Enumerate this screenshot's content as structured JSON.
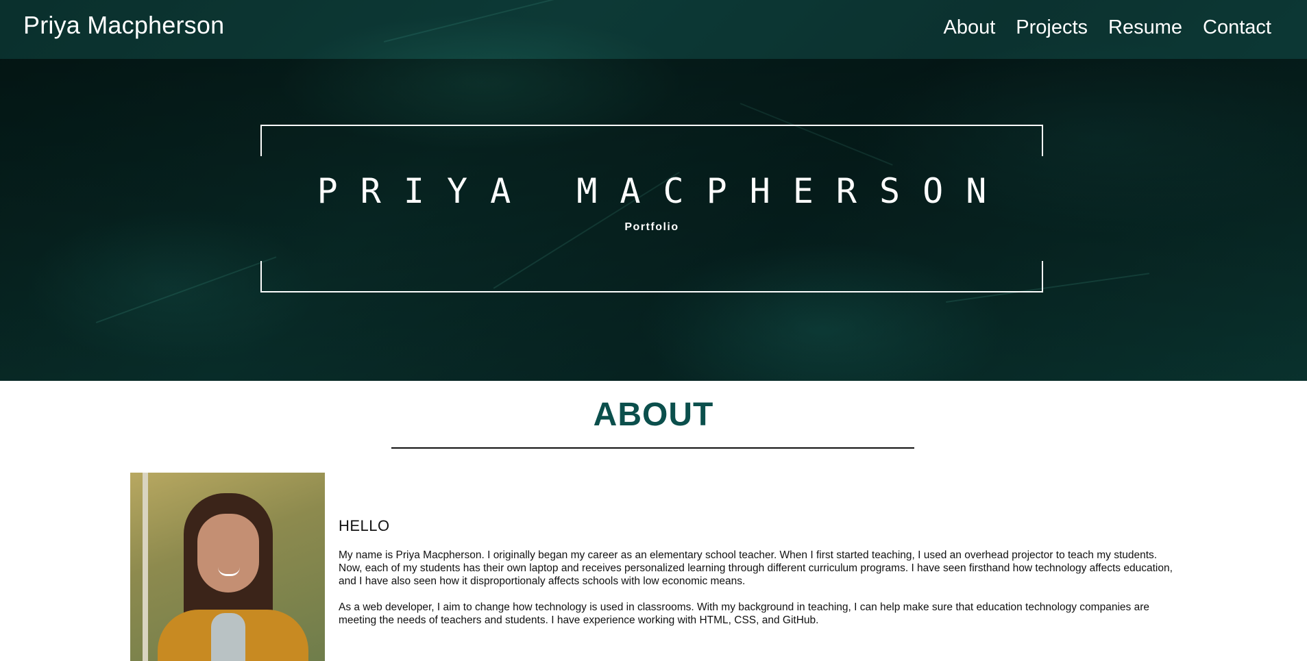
{
  "header": {
    "brand": "Priya Macpherson",
    "nav": [
      {
        "label": "About"
      },
      {
        "label": "Projects"
      },
      {
        "label": "Resume"
      },
      {
        "label": "Contact"
      }
    ]
  },
  "hero": {
    "title": "PRIYA MACPHERSON",
    "subtitle": "Portfolio"
  },
  "about": {
    "heading": "ABOUT",
    "greeting": "HELLO",
    "paragraphs": [
      "My name is Priya Macpherson. I originally began my career as an elementary school teacher. When I first started teaching, I used an overhead projector to teach my students. Now, each of my students has their own laptop and receives personalized learning through different curriculum programs. I have seen firsthand how technology affects education, and I have also seen how it disproportionaly affects schools with low economic means.",
      "As a web developer, I aim to change how technology is used in classrooms. With my background in teaching, I can help make sure that education technology companies are meeting the needs of teachers and students. I have experience working with HTML, CSS, and GitHub."
    ]
  },
  "colors": {
    "accent": "#0b4f4c",
    "hero_bg": "#062522",
    "text": "#111111"
  }
}
